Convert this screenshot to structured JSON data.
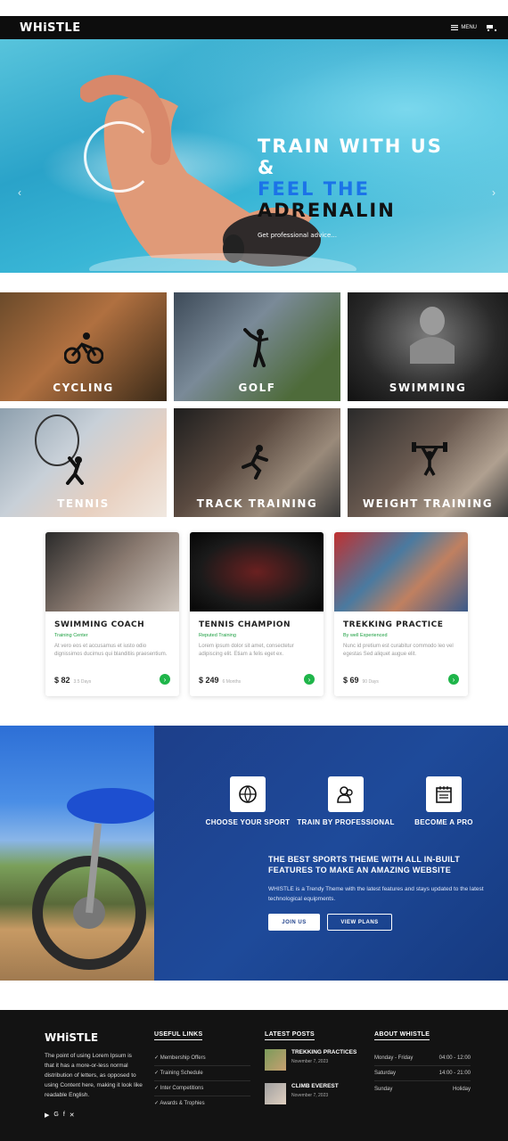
{
  "nav": {
    "logo": "WHiSTLE",
    "menu_label": "MENU"
  },
  "hero": {
    "line1": "TRAIN WITH US",
    "line2": "&",
    "line3": "FEEL THE",
    "line4": "ADRENALIN",
    "subtitle": "Get professional advice..."
  },
  "sports": [
    {
      "label": "CYCLING"
    },
    {
      "label": "GOLF"
    },
    {
      "label": "SWIMMING"
    },
    {
      "label": "TENNIS"
    },
    {
      "label": "TRACK TRAINING"
    },
    {
      "label": "WEIGHT TRAINING"
    }
  ],
  "cards": [
    {
      "title": "SWIMMING COACH",
      "subtitle": "Training Center",
      "desc": "At vero eos et accusamus et iusto odio dignissimos ducimus qui blanditiis praesentium.",
      "price": "$ 82",
      "period": "3.5 Days"
    },
    {
      "title": "TENNIS CHAMPION",
      "subtitle": "Reputed Training",
      "desc": "Lorem ipsum dolor sit amet, consectetur adipiscing elit. Etiam a felis eget ex.",
      "price": "$ 249",
      "period": "6 Months"
    },
    {
      "title": "TREKKING PRACTICE",
      "subtitle": "By well Experienced",
      "desc": "Nunc id pretium est curabitur commodo leo vel egestas Sed aliquet augue elit.",
      "price": "$ 69",
      "period": "90 Days"
    }
  ],
  "features": [
    {
      "label": "CHOOSE YOUR SPORT"
    },
    {
      "label": "TRAIN BY PROFESSIONAL"
    },
    {
      "label": "BECOME A PRO"
    }
  ],
  "promo": {
    "heading": "THE BEST SPORTS THEME WITH ALL IN-BUILT FEATURES TO MAKE AN AMAZING WEBSITE",
    "desc": "WHISTLE is a Trendy Theme with the latest features and stays updated to the latest technological equipments.",
    "join": "JOIN US",
    "plans": "VIEW PLANS"
  },
  "footer": {
    "logo": "WHiSTLE",
    "about": "The point of using Lorem Ipsum is that it has a more-or-less normal distribution of letters, as opposed to using Content here, making it look like readable English.",
    "links_title": "USEFUL LINKS",
    "links": [
      "✓ Membership Offers",
      "✓ Training Schedule",
      "✓ Inter Competitions",
      "✓ Awards & Trophies"
    ],
    "posts_title": "LATEST POSTS",
    "posts": [
      {
        "title": "TREKKING PRACTICES",
        "date": "November 7, 2023"
      },
      {
        "title": "CLIMB EVEREST",
        "date": "November 7, 2023"
      }
    ],
    "about_title": "ABOUT WHISTLE",
    "hours": [
      {
        "day": "Monday - Friday",
        "time": "04:00 - 12:00"
      },
      {
        "day": "Saturday",
        "time": "14:00 - 21:00"
      },
      {
        "day": "Sunday",
        "time": "Holiday"
      }
    ]
  }
}
